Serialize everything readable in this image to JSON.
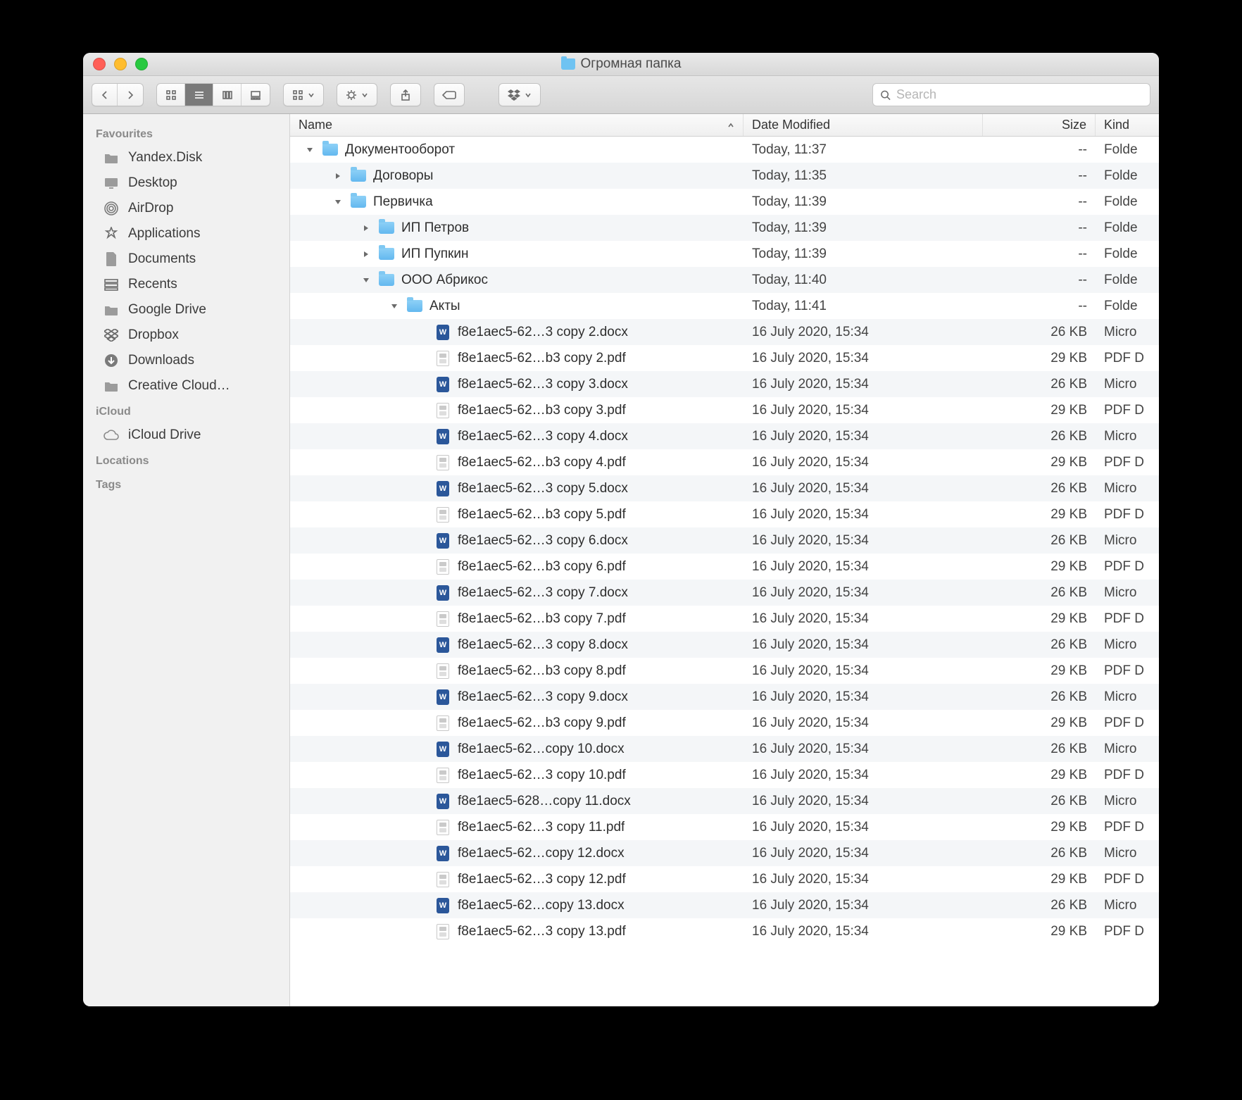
{
  "window": {
    "title": "Огромная папка"
  },
  "search": {
    "placeholder": "Search"
  },
  "sidebar": {
    "sections": [
      {
        "header": "Favourites",
        "items": [
          {
            "label": "Yandex.Disk",
            "icon": "folder"
          },
          {
            "label": "Desktop",
            "icon": "desktop"
          },
          {
            "label": "AirDrop",
            "icon": "airdrop"
          },
          {
            "label": "Applications",
            "icon": "apps"
          },
          {
            "label": "Documents",
            "icon": "doc"
          },
          {
            "label": "Recents",
            "icon": "recents"
          },
          {
            "label": "Google Drive",
            "icon": "folder"
          },
          {
            "label": "Dropbox",
            "icon": "dropbox"
          },
          {
            "label": "Downloads",
            "icon": "downloads"
          },
          {
            "label": "Creative Cloud…",
            "icon": "folder"
          }
        ]
      },
      {
        "header": "iCloud",
        "items": [
          {
            "label": "iCloud Drive",
            "icon": "cloud"
          }
        ]
      },
      {
        "header": "Locations",
        "items": []
      },
      {
        "header": "Tags",
        "items": []
      }
    ]
  },
  "columns": {
    "name": "Name",
    "date": "Date Modified",
    "size": "Size",
    "kind": "Kind"
  },
  "rows": [
    {
      "indent": 0,
      "disclosure": "open",
      "type": "folder",
      "name": "Документооборот",
      "date": "Today, 11:37",
      "size": "--",
      "kind": "Folder"
    },
    {
      "indent": 1,
      "disclosure": "closed",
      "type": "folder",
      "name": "Договоры",
      "date": "Today, 11:35",
      "size": "--",
      "kind": "Folder"
    },
    {
      "indent": 1,
      "disclosure": "open",
      "type": "folder",
      "name": "Первичка",
      "date": "Today, 11:39",
      "size": "--",
      "kind": "Folder"
    },
    {
      "indent": 2,
      "disclosure": "closed",
      "type": "folder",
      "name": "ИП Петров",
      "date": "Today, 11:39",
      "size": "--",
      "kind": "Folder"
    },
    {
      "indent": 2,
      "disclosure": "closed",
      "type": "folder",
      "name": "ИП Пупкин",
      "date": "Today, 11:39",
      "size": "--",
      "kind": "Folder"
    },
    {
      "indent": 2,
      "disclosure": "open",
      "type": "folder",
      "name": "ООО Абрикос",
      "date": "Today, 11:40",
      "size": "--",
      "kind": "Folder"
    },
    {
      "indent": 3,
      "disclosure": "open",
      "type": "folder",
      "name": "Акты",
      "date": "Today, 11:41",
      "size": "--",
      "kind": "Folder"
    },
    {
      "indent": 4,
      "disclosure": "none",
      "type": "docx",
      "name": "f8e1aec5-62…3 copy 2.docx",
      "date": "16 July 2020, 15:34",
      "size": "26 KB",
      "kind": "Microsoft Word"
    },
    {
      "indent": 4,
      "disclosure": "none",
      "type": "pdf",
      "name": "f8e1aec5-62…b3 copy 2.pdf",
      "date": "16 July 2020, 15:34",
      "size": "29 KB",
      "kind": "PDF Document"
    },
    {
      "indent": 4,
      "disclosure": "none",
      "type": "docx",
      "name": "f8e1aec5-62…3 copy 3.docx",
      "date": "16 July 2020, 15:34",
      "size": "26 KB",
      "kind": "Microsoft Word"
    },
    {
      "indent": 4,
      "disclosure": "none",
      "type": "pdf",
      "name": "f8e1aec5-62…b3 copy 3.pdf",
      "date": "16 July 2020, 15:34",
      "size": "29 KB",
      "kind": "PDF Document"
    },
    {
      "indent": 4,
      "disclosure": "none",
      "type": "docx",
      "name": "f8e1aec5-62…3 copy 4.docx",
      "date": "16 July 2020, 15:34",
      "size": "26 KB",
      "kind": "Microsoft Word"
    },
    {
      "indent": 4,
      "disclosure": "none",
      "type": "pdf",
      "name": "f8e1aec5-62…b3 copy 4.pdf",
      "date": "16 July 2020, 15:34",
      "size": "29 KB",
      "kind": "PDF Document"
    },
    {
      "indent": 4,
      "disclosure": "none",
      "type": "docx",
      "name": "f8e1aec5-62…3 copy 5.docx",
      "date": "16 July 2020, 15:34",
      "size": "26 KB",
      "kind": "Microsoft Word"
    },
    {
      "indent": 4,
      "disclosure": "none",
      "type": "pdf",
      "name": "f8e1aec5-62…b3 copy 5.pdf",
      "date": "16 July 2020, 15:34",
      "size": "29 KB",
      "kind": "PDF Document"
    },
    {
      "indent": 4,
      "disclosure": "none",
      "type": "docx",
      "name": "f8e1aec5-62…3 copy 6.docx",
      "date": "16 July 2020, 15:34",
      "size": "26 KB",
      "kind": "Microsoft Word"
    },
    {
      "indent": 4,
      "disclosure": "none",
      "type": "pdf",
      "name": "f8e1aec5-62…b3 copy 6.pdf",
      "date": "16 July 2020, 15:34",
      "size": "29 KB",
      "kind": "PDF Document"
    },
    {
      "indent": 4,
      "disclosure": "none",
      "type": "docx",
      "name": "f8e1aec5-62…3 copy 7.docx",
      "date": "16 July 2020, 15:34",
      "size": "26 KB",
      "kind": "Microsoft Word"
    },
    {
      "indent": 4,
      "disclosure": "none",
      "type": "pdf",
      "name": "f8e1aec5-62…b3 copy 7.pdf",
      "date": "16 July 2020, 15:34",
      "size": "29 KB",
      "kind": "PDF Document"
    },
    {
      "indent": 4,
      "disclosure": "none",
      "type": "docx",
      "name": "f8e1aec5-62…3 copy 8.docx",
      "date": "16 July 2020, 15:34",
      "size": "26 KB",
      "kind": "Microsoft Word"
    },
    {
      "indent": 4,
      "disclosure": "none",
      "type": "pdf",
      "name": "f8e1aec5-62…b3 copy 8.pdf",
      "date": "16 July 2020, 15:34",
      "size": "29 KB",
      "kind": "PDF Document"
    },
    {
      "indent": 4,
      "disclosure": "none",
      "type": "docx",
      "name": "f8e1aec5-62…3 copy 9.docx",
      "date": "16 July 2020, 15:34",
      "size": "26 KB",
      "kind": "Microsoft Word"
    },
    {
      "indent": 4,
      "disclosure": "none",
      "type": "pdf",
      "name": "f8e1aec5-62…b3 copy 9.pdf",
      "date": "16 July 2020, 15:34",
      "size": "29 KB",
      "kind": "PDF Document"
    },
    {
      "indent": 4,
      "disclosure": "none",
      "type": "docx",
      "name": "f8e1aec5-62…copy 10.docx",
      "date": "16 July 2020, 15:34",
      "size": "26 KB",
      "kind": "Microsoft Word"
    },
    {
      "indent": 4,
      "disclosure": "none",
      "type": "pdf",
      "name": "f8e1aec5-62…3 copy 10.pdf",
      "date": "16 July 2020, 15:34",
      "size": "29 KB",
      "kind": "PDF Document"
    },
    {
      "indent": 4,
      "disclosure": "none",
      "type": "docx",
      "name": "f8e1aec5-628…copy 11.docx",
      "date": "16 July 2020, 15:34",
      "size": "26 KB",
      "kind": "Microsoft Word"
    },
    {
      "indent": 4,
      "disclosure": "none",
      "type": "pdf",
      "name": "f8e1aec5-62…3 copy 11.pdf",
      "date": "16 July 2020, 15:34",
      "size": "29 KB",
      "kind": "PDF Document"
    },
    {
      "indent": 4,
      "disclosure": "none",
      "type": "docx",
      "name": "f8e1aec5-62…copy 12.docx",
      "date": "16 July 2020, 15:34",
      "size": "26 KB",
      "kind": "Microsoft Word"
    },
    {
      "indent": 4,
      "disclosure": "none",
      "type": "pdf",
      "name": "f8e1aec5-62…3 copy 12.pdf",
      "date": "16 July 2020, 15:34",
      "size": "29 KB",
      "kind": "PDF Document"
    },
    {
      "indent": 4,
      "disclosure": "none",
      "type": "docx",
      "name": "f8e1aec5-62…copy 13.docx",
      "date": "16 July 2020, 15:34",
      "size": "26 KB",
      "kind": "Microsoft Word"
    },
    {
      "indent": 4,
      "disclosure": "none",
      "type": "pdf",
      "name": "f8e1aec5-62…3 copy 13.pdf",
      "date": "16 July 2020, 15:34",
      "size": "29 KB",
      "kind": "PDF Document"
    }
  ],
  "kind_trunc": {
    "Folder": "Folde",
    "Microsoft Word": "Micro",
    "PDF Document": "PDF D"
  }
}
